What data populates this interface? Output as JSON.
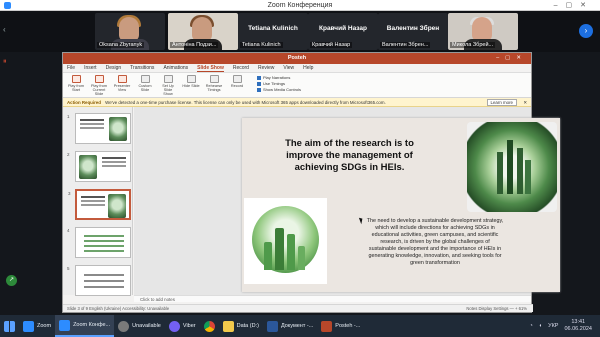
{
  "window": {
    "title": "Zoom Конференция"
  },
  "participants": [
    {
      "name": "Oksana Zbyranyk",
      "has_video": true
    },
    {
      "name": "Антоніна Подзи...",
      "has_video": true
    },
    {
      "name": "Tetiana Kulinich",
      "label": "Tetiana Kulinich",
      "has_video": false
    },
    {
      "name": "Кравчий Назар",
      "label": "Кравчий Назар",
      "has_video": false
    },
    {
      "name": "Валентин Збрен...",
      "label": "Валентин Збрен",
      "has_video": false
    },
    {
      "name": "Микола Збрей...",
      "has_video": true
    }
  ],
  "ppt": {
    "file": "Posteh",
    "menu": [
      "File",
      "Insert",
      "Design",
      "Transitions",
      "Animations",
      "Slide Show",
      "Record",
      "Review",
      "View",
      "Help"
    ],
    "active_menu": "Slide Show",
    "ribbon": [
      "Play from Start",
      "Play from Current Slide",
      "Presenter View",
      "Custom Slide",
      "Set Up Slide Show",
      "Hide Slide",
      "Rehearse Timings",
      "Record"
    ],
    "checks": [
      "Play Narrations",
      "Use Timings",
      "Show Media Controls"
    ],
    "infobar_title": "Action Required",
    "infobar_text": "We've detected a one-time purchase license. This license can only be used with Microsoft 365 apps downloaded directly from Microsoft365.com.",
    "infobar_button": "Learn more",
    "thumb_numbers": [
      "1",
      "2",
      "3",
      "4",
      "5"
    ],
    "notes_placeholder": "Click to add notes",
    "status_left": "Slide 3 of 9   English (Ukraine)   Accessibility: Unavailable",
    "status_right": "Notes   Display Settings   —  +  61%"
  },
  "slide": {
    "title": "The aim of the research is to improve the management of achieving SDGs in HEIs.",
    "body": "The need to develop a sustainable development strategy, which will include directions for achieving SDGs in educational activities, green campuses, and scientific research, is driven by the global challenges of sustainable development and the importance of HEIs in generating knowledge, innovation, and seeking tools for green transformation"
  },
  "taskbar": {
    "items": [
      "Zoom",
      "Zoom Конфе...",
      "Unavailable",
      "Viber",
      "Data (D:)",
      "Документ -...",
      "Posteh -..."
    ],
    "lang": "УКР",
    "time": "13:41",
    "date": "06.06.2024"
  },
  "colors": {
    "ppt_accent": "#b7472a",
    "zoom_blue": "#2d8cff",
    "taskbar": "#1f2a37"
  }
}
